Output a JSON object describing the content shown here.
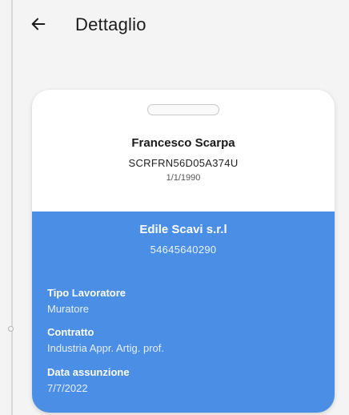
{
  "header": {
    "back_icon": "arrow-left-icon",
    "title": "Dettaglio"
  },
  "worker": {
    "name": "Francesco Scarpa",
    "fiscal_code": "SCRFRN56D05A374U",
    "birth_date": "1/1/1990"
  },
  "company": {
    "name": "Edile Scavi s.r.l",
    "vat_number": "54645640290"
  },
  "fields": [
    {
      "label": "Tipo Lavoratore",
      "value": "Muratore"
    },
    {
      "label": "Contratto",
      "value": "Industria Appr. Artig. prof."
    },
    {
      "label": "Data assunzione",
      "value": "7/7/2022"
    }
  ],
  "colors": {
    "card_accent": "#4a8ee6",
    "background": "#f4f4f4",
    "card_top": "#ffffff"
  }
}
